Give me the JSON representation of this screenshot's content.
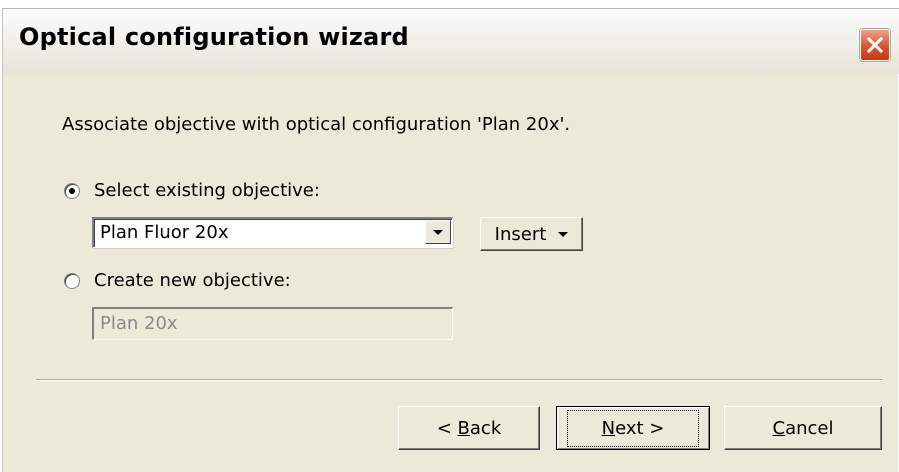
{
  "window": {
    "title": "Optical configuration wizard",
    "close_icon": "close-icon"
  },
  "content": {
    "description": "Associate objective with optical configuration 'Plan 20x'.",
    "option_existing": {
      "label": "Select existing objective:",
      "selected": true
    },
    "objective_combo": {
      "value": "Plan Fluor 20x",
      "icon": "chevron-down-icon"
    },
    "insert_button": {
      "label": "Insert"
    },
    "option_new": {
      "label": "Create new objective:",
      "selected": false
    },
    "new_objective_field": {
      "value": "Plan 20x",
      "disabled": true
    }
  },
  "footer": {
    "back": {
      "mnemonic": "B",
      "rest": "ack",
      "prefix": "< "
    },
    "next": {
      "mnemonic": "N",
      "rest": "ext",
      "suffix": " >"
    },
    "cancel": {
      "mnemonic": "C",
      "rest": "ancel"
    }
  },
  "colors": {
    "dialog_bg": "#ece9d8",
    "close_button": "#d8552e"
  }
}
